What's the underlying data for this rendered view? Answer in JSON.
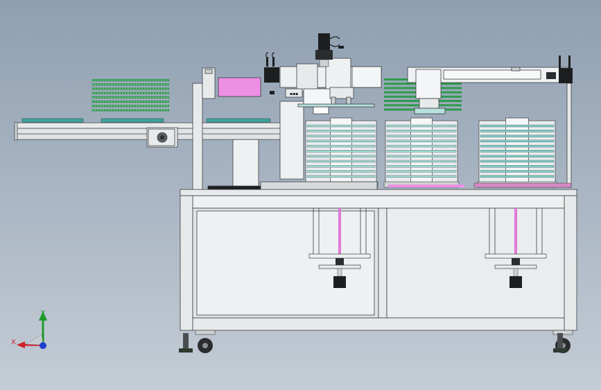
{
  "viewport": {
    "background_top": "#8f9fb1",
    "background_bottom": "#c4ccd5"
  },
  "palette": {
    "frame": "#e7e9ea",
    "frame_dark": "#55595d",
    "line": "#3a3d40",
    "pcb_green": "#2e9a4d",
    "pcb_teal": "#39a6a0",
    "magenta_panel": "#ee8fe6",
    "rod_pink": "#e07ad6",
    "motor_black": "#1d1e20",
    "wheel": "#2b2c2e"
  },
  "triad": {
    "x_label": "X",
    "y_label": "Y",
    "x_color": "#d0202a",
    "y_color": "#1e9a2c",
    "z_color": "#1f3fd0"
  }
}
